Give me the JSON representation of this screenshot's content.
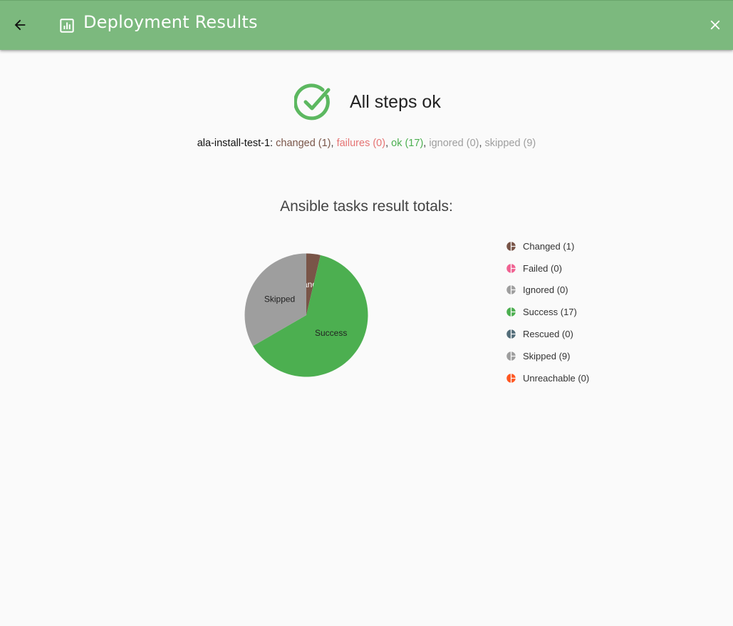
{
  "header": {
    "title": "Deployment Results",
    "back_icon": "arrow-back-icon",
    "title_icon": "chart-report-icon",
    "close_icon": "close-icon",
    "background": "#7cb97e"
  },
  "status": {
    "icon": "check-circle-icon",
    "text": "All steps ok",
    "color": "#5cb860"
  },
  "summary": {
    "host": "ala-install-test-1:",
    "changed": "changed (1)",
    "failures": "failures (0)",
    "ok": "ok (17)",
    "ignored": "ignored (0)",
    "skipped": "skipped (9)",
    "separator": ", "
  },
  "chart_data": {
    "type": "pie",
    "title": "Ansible tasks result totals:",
    "categories": [
      "Changed",
      "Failed",
      "Ignored",
      "Success",
      "Rescued",
      "Skipped",
      "Unreachable"
    ],
    "values": [
      1,
      0,
      0,
      17,
      0,
      9,
      0
    ],
    "colors": [
      "#795548",
      "#f06292",
      "#9e9e9e",
      "#4caf50",
      "#546e7a",
      "#9e9e9e",
      "#ff5722"
    ],
    "label_colors": [
      "#ffffff",
      "#222222",
      "#222222",
      "#222222",
      "#222222",
      "#222222",
      "#222222"
    ],
    "legend": [
      "Changed (1)",
      "Failed (0)",
      "Ignored (0)",
      "Success (17)",
      "Rescued (0)",
      "Skipped (9)",
      "Unreachable (0)"
    ],
    "legend_placement": "right"
  }
}
